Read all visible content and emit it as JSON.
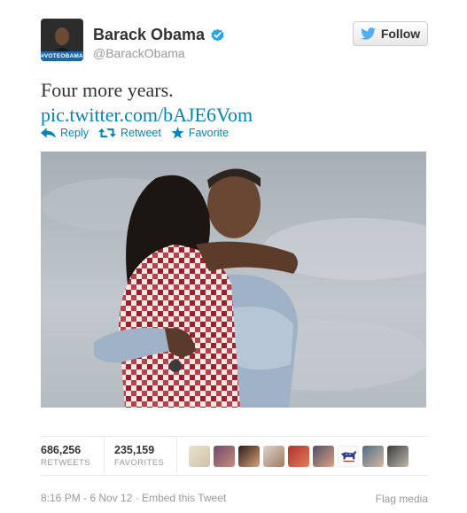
{
  "user": {
    "name": "Barack Obama",
    "handle": "@BarackObama",
    "avatar_tag": "#VOTEOBAMA",
    "verified": true
  },
  "follow_label": "Follow",
  "tweet": {
    "text": "Four more years.",
    "link": "pic.twitter.com/bAJE6Vom"
  },
  "actions": {
    "reply": "Reply",
    "retweet": "Retweet",
    "favorite": "Favorite"
  },
  "stats": {
    "retweets": {
      "value": "686,256",
      "label": "RETWEETS"
    },
    "favorites": {
      "value": "235,159",
      "label": "FAVORITES"
    }
  },
  "meta": {
    "timestamp": "8:16 PM - 6 Nov 12",
    "separator": " · ",
    "embed": "Embed this Tweet",
    "flag": "Flag media"
  },
  "colors": {
    "link": "#0084b4",
    "twitter_blue": "#55acee",
    "verified": "#2aa3ef",
    "muted": "#999999"
  },
  "favoriters_count": 9
}
